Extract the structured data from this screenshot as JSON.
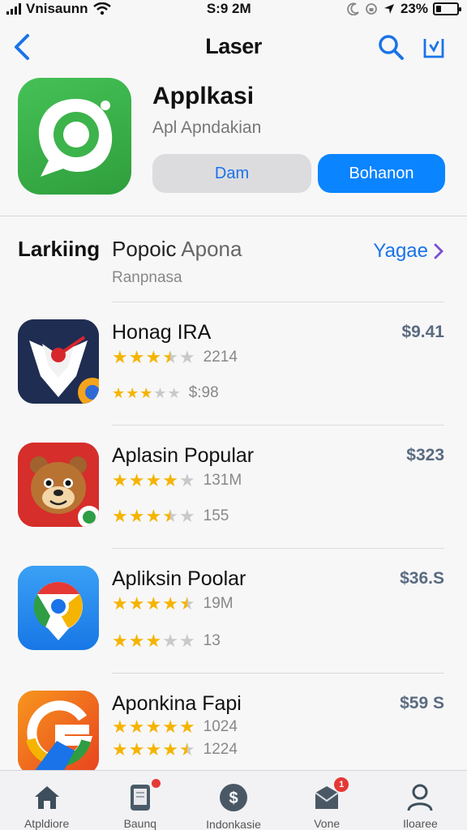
{
  "status_bar": {
    "carrier": "Vnisaunn",
    "time": "S:9 2M",
    "battery_text": "23%",
    "battery_level": 0.23
  },
  "nav": {
    "title": "Laser"
  },
  "app": {
    "name": "Applkasi",
    "subtitle": "Apl Apndakian",
    "secondary_button": "Dam",
    "primary_button": "Bohanon",
    "icon_color": "#34a853"
  },
  "section": {
    "title_bold": "Larkiing",
    "title_rest": "Popoic",
    "title_muted": "Apona",
    "subtitle": "Ranpnasa",
    "see_all": "Yagae",
    "see_all_icon": "chevron-right-icon"
  },
  "apps": [
    {
      "name": "Honag IRA",
      "price": "$9.41",
      "icon": "shield-heart-icon",
      "rating1": 3.5,
      "count1": "2214",
      "rating2": 3.0,
      "count2": "$:98"
    },
    {
      "name": "Aplasin Popular",
      "price": "$323",
      "icon": "bear-face-icon",
      "rating1": 4.0,
      "count1": "131M",
      "rating2": 3.5,
      "count2": "155"
    },
    {
      "name": "Apliksin Poolar",
      "price": "$36.S",
      "icon": "chrome-icon",
      "rating1": 4.5,
      "count1": "19M",
      "rating2": 3.0,
      "count2": "13"
    },
    {
      "name": "Aponkina Fapi",
      "price": "$59 S",
      "icon": "google-g-icon",
      "rating1": 5,
      "count1": "1024",
      "rating2": 4.5,
      "count2": "1224"
    }
  ],
  "tabs": [
    {
      "label": "Atpldiore",
      "icon": "home-icon",
      "badge": ""
    },
    {
      "label": "Baunq",
      "icon": "phone-icon",
      "badge": "dot"
    },
    {
      "label": "Indonkasie",
      "icon": "dollar-coin-icon",
      "badge": ""
    },
    {
      "label": "Vone",
      "icon": "mailbox-icon",
      "badge": "1"
    },
    {
      "label": "Iloaree",
      "icon": "person-icon",
      "badge": ""
    }
  ],
  "colors": {
    "accent": "#0a84ff",
    "star": "#f5b400",
    "badge": "#e53935"
  }
}
